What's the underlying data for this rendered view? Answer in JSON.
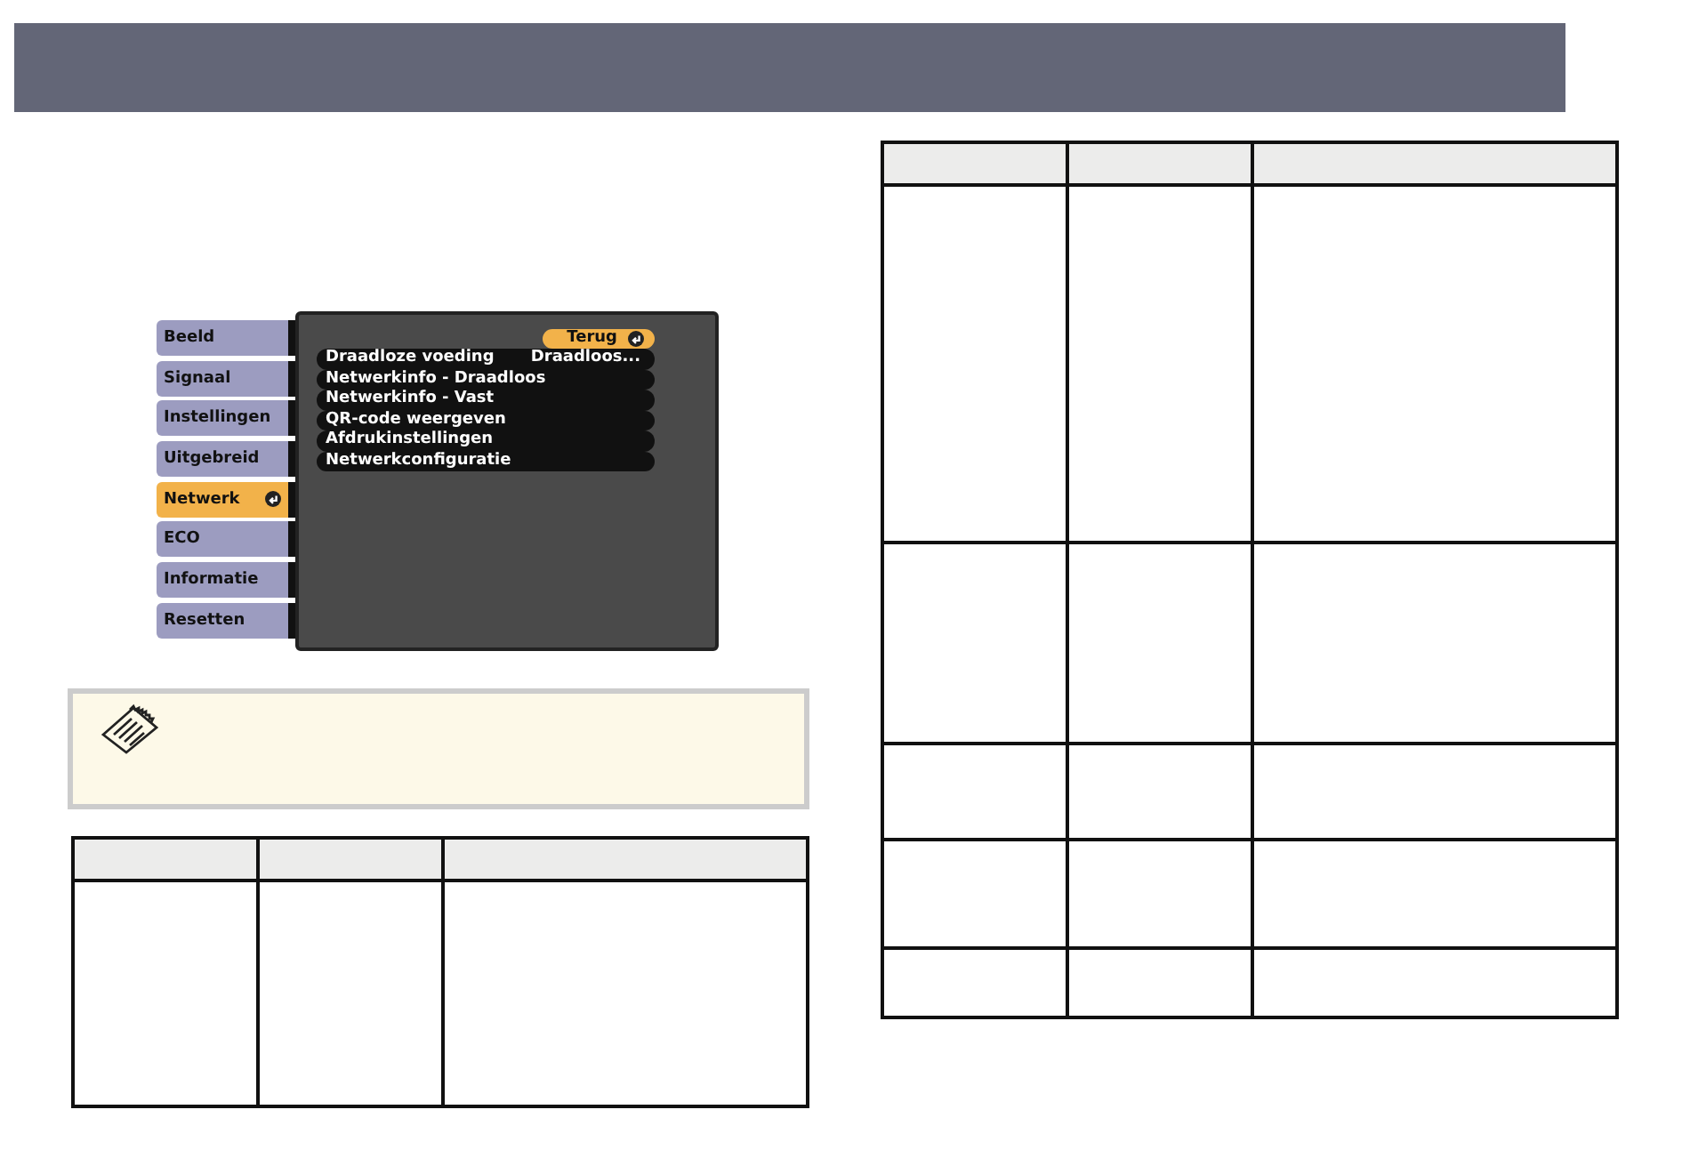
{
  "menu": {
    "tabs": [
      {
        "label": "Beeld",
        "selected": false
      },
      {
        "label": "Signaal",
        "selected": false
      },
      {
        "label": "Instellingen",
        "selected": false
      },
      {
        "label": "Uitgebreid",
        "selected": false
      },
      {
        "label": "Netwerk",
        "selected": true
      },
      {
        "label": "ECO",
        "selected": false
      },
      {
        "label": "Informatie",
        "selected": false
      },
      {
        "label": "Resetten",
        "selected": false
      }
    ],
    "back_button": "Terug",
    "items": [
      {
        "label": "Draadloze voeding",
        "value": "Draadloos..."
      },
      {
        "label": "Netwerkinfo - Draadloos"
      },
      {
        "label": "Netwerkinfo - Vast"
      },
      {
        "label": "QR-code weergeven"
      },
      {
        "label": "Afdrukinstellingen"
      },
      {
        "label": "Netwerkconfiguratie"
      }
    ]
  }
}
